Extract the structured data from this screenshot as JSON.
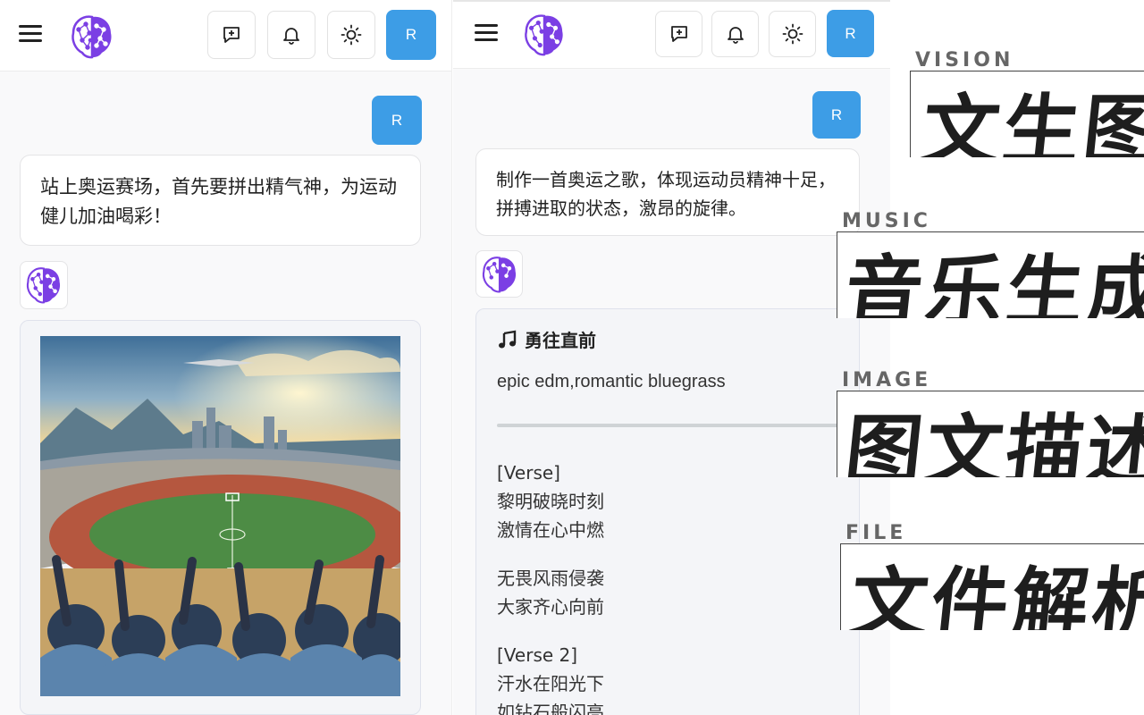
{
  "left": {
    "header": {
      "menu_icon": "menu-icon",
      "logo_icon": "brain-logo",
      "new_chat_icon": "new-chat-icon",
      "bell_icon": "bell-icon",
      "theme_icon": "sun-icon",
      "avatar_label": "R"
    },
    "user_avatar_label": "R",
    "user_message": "站上奥运赛场，首先要拼出精气神，为运动健儿加油喝彩！",
    "image_caption_icon": "stadium-image"
  },
  "right": {
    "header": {
      "menu_icon": "menu-icon",
      "logo_icon": "brain-logo",
      "new_chat_icon": "new-chat-icon",
      "bell_icon": "bell-icon",
      "theme_icon": "sun-icon",
      "avatar_label": "R"
    },
    "user_avatar_label": "R",
    "user_message": "制作一首奥运之歌，体现运动员精神十足，拼搏进取的状态，激昂的旋律。",
    "song": {
      "icon": "music-note-icon",
      "title": "勇往直前",
      "style": "epic edm,romantic bluegrass",
      "stanzas": [
        [
          "[Verse]",
          "黎明破晓时刻",
          "激情在心中燃"
        ],
        [
          "无畏风雨侵袭",
          "大家齐心向前"
        ],
        [
          "[Verse 2]",
          "汗水在阳光下",
          "如钻石般闪亮"
        ]
      ]
    }
  },
  "features": [
    {
      "en": "VISION",
      "cn": "文生图"
    },
    {
      "en": "MUSIC",
      "cn": "音乐生成"
    },
    {
      "en": "IMAGE",
      "cn": "图文描述"
    },
    {
      "en": "FILE",
      "cn": "文件解析"
    }
  ],
  "colors": {
    "accent": "#3d9de6",
    "logo_purple": "#7b3fe4"
  }
}
